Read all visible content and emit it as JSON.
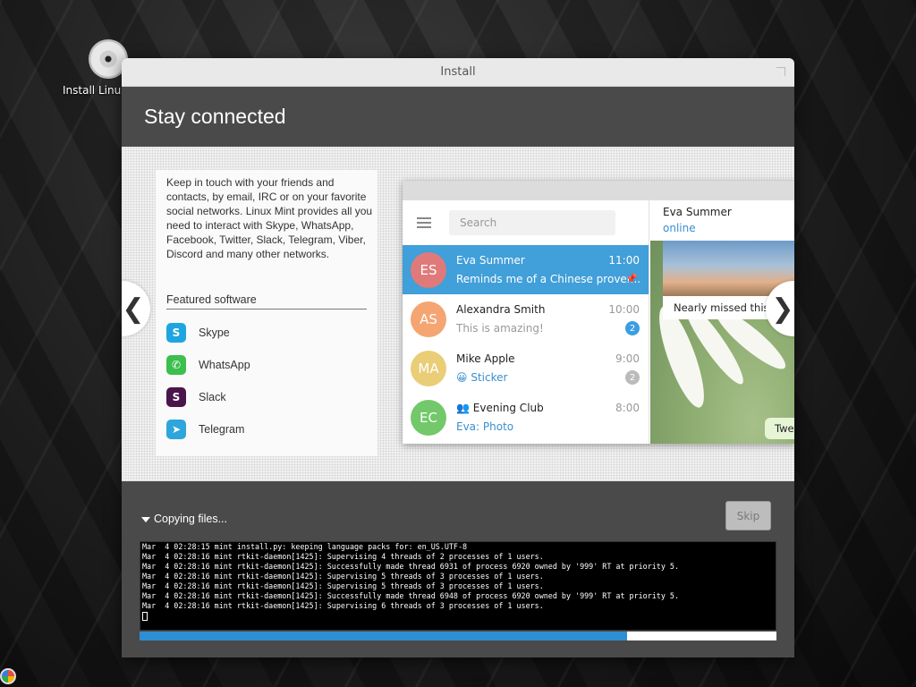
{
  "desktop": {
    "icon_label": "Install Linux Mint",
    "icon_name": "disc-icon"
  },
  "window": {
    "title": "Install"
  },
  "banner": {
    "heading": "Stay connected"
  },
  "slide": {
    "intro": "Keep in touch with your friends and contacts, by email, IRC or on your favorite social networks. Linux Mint provides all you need to interact with Skype, WhatsApp, Facebook, Twitter, Slack, Telegram, Viber, Discord and many other networks.",
    "featured_label": "Featured software",
    "apps": [
      {
        "name": "Skype",
        "icon": "skype-icon",
        "color": "#1ea5e0",
        "glyph": "S"
      },
      {
        "name": "WhatsApp",
        "icon": "whatsapp-icon",
        "color": "#3cbf4d",
        "glyph": "✆"
      },
      {
        "name": "Slack",
        "icon": "slack-icon",
        "color": "#4a154b",
        "glyph": "S"
      },
      {
        "name": "Telegram",
        "icon": "telegram-icon",
        "color": "#2ea6db",
        "glyph": "➤"
      }
    ],
    "prev_glyph": "❮",
    "next_glyph": "❯"
  },
  "telegram": {
    "search_placeholder": "Search",
    "chats": [
      {
        "initials": "ES",
        "name": "Eva Summer",
        "time": "11:00",
        "message": "Reminds me of a Chinese prover...",
        "color": "#e07a7a",
        "selected": true,
        "pinned": true
      },
      {
        "initials": "AS",
        "name": "Alexandra Smith",
        "time": "10:00",
        "message": "This is amazing!",
        "color": "#f5a572",
        "badge": "2",
        "badge_color": "#3a9ee0"
      },
      {
        "initials": "MA",
        "name": "Mike Apple",
        "time": "9:00",
        "message": "😀 Sticker",
        "color": "#e9cd77",
        "badge": "2",
        "badge_color": "#bbbbbb",
        "message_blue": true
      },
      {
        "initials": "EC",
        "name": "Evening Club",
        "time": "8:00",
        "message": "Eva: Photo",
        "color": "#72c86a",
        "message_blue": true,
        "group": true
      }
    ],
    "right_name": "Eva Summer",
    "right_status": "online",
    "caption": "Nearly missed this s",
    "bubble": "Twe"
  },
  "footer": {
    "status": "Copying files...",
    "skip_label": "Skip",
    "log": [
      "Mar  4 02:28:15 mint install.py: keeping language packs for: en_US.UTF-8",
      "Mar  4 02:28:16 mint rtkit-daemon[1425]: Supervising 4 threads of 2 processes of 1 users.",
      "Mar  4 02:28:16 mint rtkit-daemon[1425]: Successfully made thread 6931 of process 6920 owned by '999' RT at priority 5.",
      "Mar  4 02:28:16 mint rtkit-daemon[1425]: Supervising 5 threads of 3 processes of 1 users.",
      "Mar  4 02:28:16 mint rtkit-daemon[1425]: Supervising 5 threads of 3 processes of 1 users.",
      "Mar  4 02:28:16 mint rtkit-daemon[1425]: Successfully made thread 6948 of process 6920 owned by '999' RT at priority 5.",
      "Mar  4 02:28:16 mint rtkit-daemon[1425]: Supervising 6 threads of 3 processes of 1 users."
    ],
    "progress_fraction": 0.765,
    "progress_color": "#2d8ed4"
  }
}
